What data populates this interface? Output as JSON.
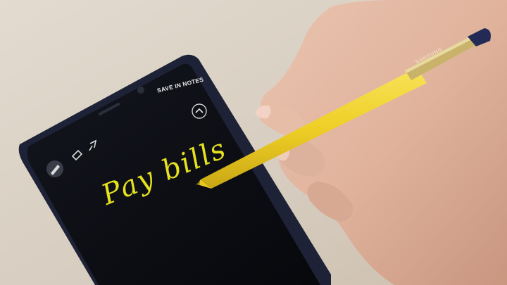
{
  "screen": {
    "save_label": "SAVE IN NOTES",
    "handwriting": "Pay bills",
    "icons": [
      "pen-tool-icon",
      "eraser-icon",
      "pin-icon",
      "collapse-chevron-icon"
    ]
  },
  "stylus": {
    "brand": "SAMSUNG",
    "body_color": "#f0d22c",
    "clip_color": "#c9b36a",
    "cap_color": "#232a55"
  },
  "phone": {
    "screen_color": "#0b0d14",
    "frame_color": "#1d2236"
  },
  "colors": {
    "ink": "#e6e21e",
    "background": "#d9cfc3",
    "skin": "#e3b9a3"
  }
}
